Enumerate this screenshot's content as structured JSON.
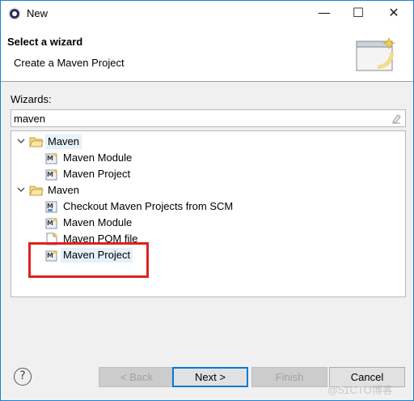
{
  "window": {
    "title": "New"
  },
  "title_controls": {
    "minimize": "—",
    "maximize": "☐",
    "close": "✕"
  },
  "banner": {
    "title": "Select a wizard",
    "description": "Create a Maven Project"
  },
  "wizards_label": "Wizards:",
  "filter": {
    "value": "maven"
  },
  "tree": {
    "groups": [
      {
        "label": "Maven",
        "items": [
          {
            "label": "Maven Module"
          },
          {
            "label": "Maven Project"
          }
        ]
      },
      {
        "label": "Maven",
        "items": [
          {
            "label": "Checkout Maven Projects from SCM"
          },
          {
            "label": "Maven Module"
          },
          {
            "label": "Maven POM file"
          },
          {
            "label": "Maven Project"
          }
        ]
      }
    ]
  },
  "footer": {
    "help": "?",
    "back_label": "< Back",
    "next_label": "Next >",
    "finish_label": "Finish",
    "cancel_label": "Cancel"
  },
  "watermark": "@51CTO博客",
  "colors": {
    "accent": "#0078d7",
    "highlight": "#e02020",
    "selection": "#e5f1fb"
  }
}
